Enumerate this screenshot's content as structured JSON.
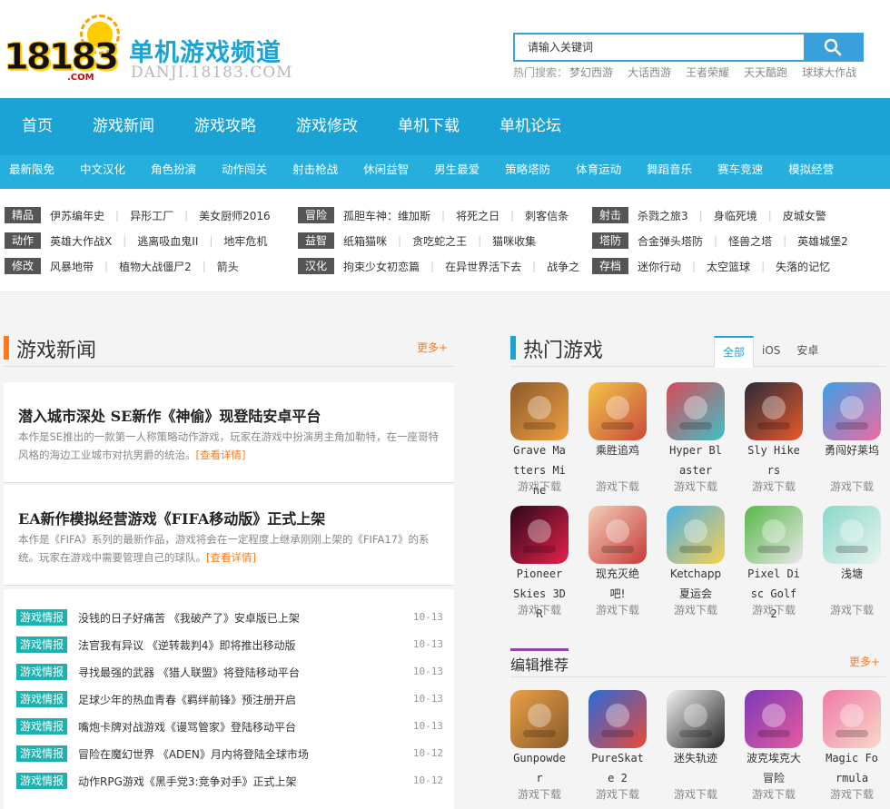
{
  "logo": {
    "number": "18183",
    "com": ".COM"
  },
  "site": {
    "title": "单机游戏频道",
    "domain": "DANJI.18183.COM"
  },
  "search": {
    "placeholder": "请输入关键词",
    "hot_label": "热门搜索：",
    "hot_keywords": [
      "梦幻西游",
      "大话西游",
      "王者荣耀",
      "天天酷跑",
      "球球大作战"
    ]
  },
  "main_nav": [
    "首页",
    "游戏新闻",
    "游戏攻略",
    "游戏修改",
    "单机下载",
    "单机论坛"
  ],
  "sub_nav": [
    "最新限免",
    "中文汉化",
    "角色扮演",
    "动作闯关",
    "射击枪战",
    "休闲益智",
    "男生最爱",
    "策略塔防",
    "体育运动",
    "舞蹈音乐",
    "赛车竞速",
    "模拟经营"
  ],
  "tag_rows": [
    [
      {
        "cat": "精品",
        "items": [
          "伊苏编年史",
          "异形工厂",
          "美女厨师2016"
        ]
      },
      {
        "cat": "冒险",
        "items": [
          "孤胆车神：维加斯",
          "将死之日",
          "刺客信条"
        ]
      },
      {
        "cat": "射击",
        "items": [
          "杀戮之旅3",
          "身临死境",
          "皮城女警"
        ]
      }
    ],
    [
      {
        "cat": "动作",
        "items": [
          "英雄大作战X",
          "逃离吸血鬼II",
          "地牢危机"
        ]
      },
      {
        "cat": "益智",
        "items": [
          "纸箱猫咪",
          "贪吃蛇之王",
          "猫咪收集"
        ]
      },
      {
        "cat": "塔防",
        "items": [
          "合金弹头塔防",
          "怪兽之塔",
          "英雄城堡2"
        ]
      }
    ],
    [
      {
        "cat": "修改",
        "items": [
          "风暴地带",
          "植物大战僵尸2",
          "箭头"
        ]
      },
      {
        "cat": "汉化",
        "items": [
          "拘束少女初恋篇",
          "在异世界活下去",
          "战争之"
        ]
      },
      {
        "cat": "存档",
        "items": [
          "迷你行动",
          "太空篮球",
          "失落的记忆"
        ]
      }
    ]
  ],
  "news": {
    "title": "游戏新闻",
    "more": "更多+",
    "features": [
      {
        "title": "潜入城市深处 SE新作《神偷》现登陆安卓平台",
        "desc": "本作是SE推出的一款第一人称策略动作游戏，玩家在游戏中扮演男主角加勒特，在一座哥特风格的海边工业城市对抗男爵的统治。",
        "link": "[查看详情]"
      },
      {
        "title": "EA新作模拟经营游戏《FIFA移动版》正式上架",
        "desc": "本作是《FIFA》系列的最新作品，游戏将会在一定程度上继承刚刚上架的《FIFA17》的系统。玩家在游戏中需要管理自己的球队。",
        "link": "[查看详情]"
      }
    ],
    "list": [
      {
        "tag": "游戏情报",
        "text": "没钱的日子好痛苦 《我破产了》安卓版已上架",
        "date": "10-13"
      },
      {
        "tag": "游戏情报",
        "text": "法官我有异议 《逆转裁判4》即将推出移动版",
        "date": "10-13"
      },
      {
        "tag": "游戏情报",
        "text": "寻找最强的武器 《猎人联盟》将登陆移动平台",
        "date": "10-13"
      },
      {
        "tag": "游戏情报",
        "text": "足球少年的热血青春《羁绊前锋》预注册开启",
        "date": "10-13"
      },
      {
        "tag": "游戏情报",
        "text": "嘴炮卡牌对战游戏《谩骂管家》登陆移动平台",
        "date": "10-13"
      },
      {
        "tag": "游戏情报",
        "text": "冒险在魔幻世界 《ADEN》月内将登陆全球市场",
        "date": "10-12"
      },
      {
        "tag": "游戏情报",
        "text": "动作RPG游戏《黑手党3:竞争对手》正式上架",
        "date": "10-12"
      }
    ]
  },
  "hot_games": {
    "title": "热门游戏",
    "tabs": [
      "全部",
      "iOS",
      "安卓"
    ],
    "download": "游戏下载",
    "items": [
      {
        "name": "Grave Matters Mine",
        "icon": "grave-matters-icon",
        "c1": "#8a5a2b",
        "c2": "#f0a040"
      },
      {
        "name": "乘胜追鸡",
        "icon": "chicken-icon",
        "c1": "#f3c64a",
        "c2": "#c84a3a"
      },
      {
        "name": "Hyper Blaster",
        "icon": "hyper-blaster-icon",
        "c1": "#d84a58",
        "c2": "#3fc0c6"
      },
      {
        "name": "Sly Hikers",
        "icon": "sly-hikers-icon",
        "c1": "#2a2a3a",
        "c2": "#e85a2a"
      },
      {
        "name": "勇闯好莱坞",
        "icon": "hollywood-icon",
        "c1": "#3aa0e8",
        "c2": "#f06aa0"
      },
      {
        "name": "Pioneer Skies 3D R",
        "icon": "pioneer-skies-icon",
        "c1": "#2a0a1a",
        "c2": "#e8204a"
      },
      {
        "name": "现充灭绝吧!",
        "icon": "riajuu-icon",
        "c1": "#f2d0b8",
        "c2": "#c83a3a"
      },
      {
        "name": "Ketchapp夏运会",
        "icon": "summer-games-icon",
        "c1": "#4ab0e8",
        "c2": "#f8d050"
      },
      {
        "name": "Pixel Disc Golf 2",
        "icon": "disc-golf-icon",
        "c1": "#58b848",
        "c2": "#e8e8e8"
      },
      {
        "name": "浅塘",
        "icon": "qiantang-icon",
        "c1": "#8ad8c8",
        "c2": "#e8f4f0"
      }
    ]
  },
  "editor_picks": {
    "title": "编辑推荐",
    "more": "更多+",
    "download": "游戏下载",
    "items": [
      {
        "name": "Gunpowder",
        "icon": "gunpowder-icon",
        "c1": "#e8a048",
        "c2": "#8a5a28"
      },
      {
        "name": "PureSkate 2",
        "icon": "pureskate-icon",
        "c1": "#2a6ad8",
        "c2": "#e84a3a"
      },
      {
        "name": "迷失轨迹",
        "icon": "lost-track-icon",
        "c1": "#f4f4f4",
        "c2": "#222222"
      },
      {
        "name": "波克埃克大冒险",
        "icon": "adventure-icon",
        "c1": "#7a3ab8",
        "c2": "#e85aa0"
      },
      {
        "name": "Magic Formula",
        "icon": "magic-formula-icon",
        "c1": "#f07aa8",
        "c2": "#f8d8c8"
      }
    ]
  },
  "colors": {
    "brand": "#1aa3d4",
    "accent": "#ff7a1a",
    "tag": "#1bb3b0"
  }
}
